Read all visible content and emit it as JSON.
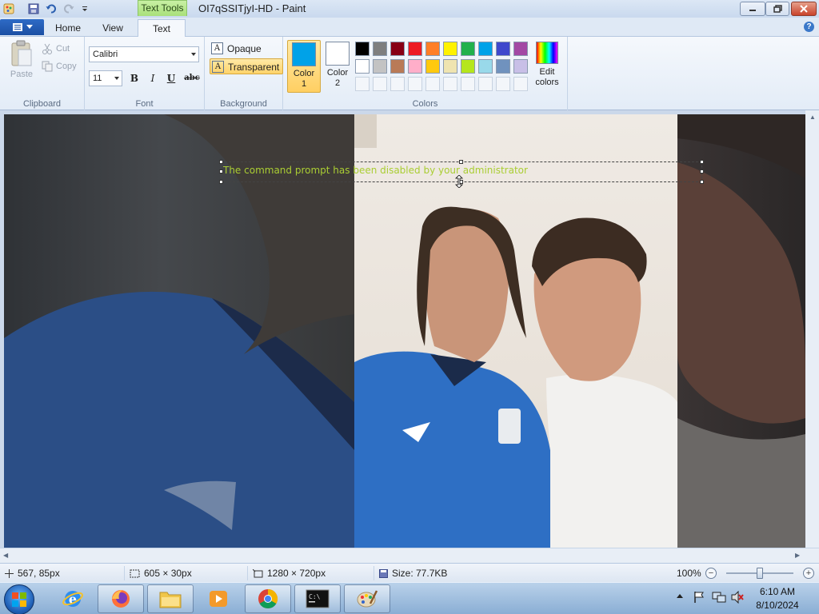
{
  "window": {
    "title": "OI7qSSITjyI-HD - Paint",
    "context_tab": "Text Tools"
  },
  "tabs": [
    {
      "label": "Home"
    },
    {
      "label": "View"
    },
    {
      "label": "Text",
      "active": true
    }
  ],
  "clipboard": {
    "paste_label": "Paste",
    "cut_label": "Cut",
    "copy_label": "Copy",
    "group_label": "Clipboard"
  },
  "font": {
    "family": "Calibri",
    "size": "11",
    "bold": "B",
    "italic": "I",
    "underline": "U",
    "strikethrough": "abc",
    "group_label": "Font"
  },
  "background": {
    "opaque_label": "Opaque",
    "transparent_label": "Transparent",
    "selected": "Transparent",
    "group_label": "Background"
  },
  "colors": {
    "color1_label": "Color\n1",
    "color1_value": "#00a2e8",
    "color2_label": "Color\n2",
    "color2_value": "#ffffff",
    "edit_label": "Edit\ncolors",
    "group_label": "Colors",
    "palette_row1": [
      "#000000",
      "#7f7f7f",
      "#880015",
      "#ed1c24",
      "#ff7f27",
      "#fff200",
      "#22b14c",
      "#00a2e8",
      "#3f48cc",
      "#a349a4"
    ],
    "palette_row2": [
      "#ffffff",
      "#c3c3c3",
      "#b97a57",
      "#ffaec9",
      "#ffc90e",
      "#efe4b0",
      "#b5e61d",
      "#99d9ea",
      "#7092be",
      "#c8bfe7"
    ],
    "palette_empty_count": 10
  },
  "canvas": {
    "overlay_text": "The command prompt has been disabled by your administrator",
    "overlay_text_color": "#aacd33"
  },
  "status": {
    "cursor_pos": "567, 85px",
    "selection_size": "605 × 30px",
    "image_size": "1280 × 720px",
    "file_size": "Size: 77.7KB",
    "zoom": "100%"
  },
  "taskbar": {
    "apps": [
      "internet-explorer",
      "firefox",
      "file-explorer",
      "media-player",
      "chrome",
      "command-prompt",
      "paint"
    ],
    "time": "6:10 AM",
    "date": "8/10/2024"
  }
}
